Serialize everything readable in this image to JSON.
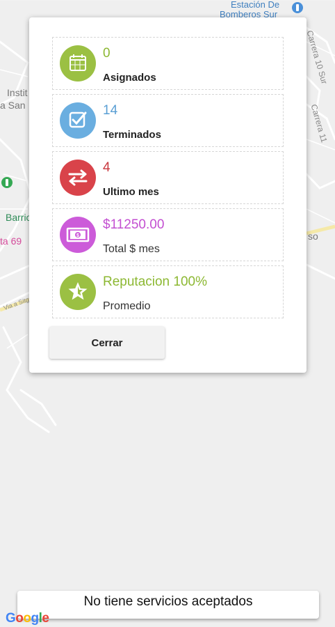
{
  "map": {
    "labels": {
      "station": "Estación De",
      "station_line2": "Bomberos Sur",
      "institute": "Instit",
      "institute_line2": "a San",
      "barrio": "Barrio",
      "ta69": "ta 69",
      "so": "so",
      "carrera10": "Carrera 10 Sur",
      "carrera11": "Carrera 11",
      "via": "Via a Sitge"
    },
    "google_logo": [
      "G",
      "o",
      "o",
      "g",
      "l",
      "e"
    ]
  },
  "dialog": {
    "stats": [
      {
        "value": "0",
        "label": "Asignados",
        "color": "#8cb832",
        "icon": "calendar-icon"
      },
      {
        "value": "14",
        "label": "Terminados",
        "color": "#5a9fd4",
        "icon": "checkbox-icon"
      },
      {
        "value": "4",
        "label": "Ultimo mes",
        "color": "#c9383f",
        "icon": "swap-arrows-icon"
      },
      {
        "value": "$11250.00",
        "label": "Total $ mes",
        "color": "#c34fd1",
        "icon": "money-bill-icon"
      },
      {
        "value": "Reputacion 100%",
        "label": "Promedio",
        "color": "#8cb832",
        "icon": "star-badge-icon"
      }
    ],
    "close_label": "Cerrar"
  },
  "status_bar": {
    "message": "No tiene servicios aceptados"
  }
}
